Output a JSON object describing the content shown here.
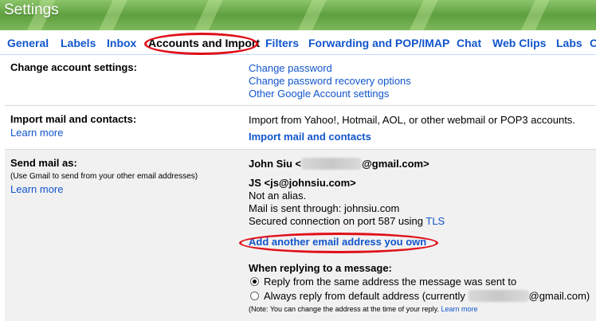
{
  "header": {
    "title": "Settings"
  },
  "tabs": [
    {
      "label": "General"
    },
    {
      "label": "Labels"
    },
    {
      "label": "Inbox"
    },
    {
      "label": "Accounts and Import"
    },
    {
      "label": "Filters"
    },
    {
      "label": "Forwarding and POP/IMAP"
    },
    {
      "label": "Chat"
    },
    {
      "label": "Web Clips"
    },
    {
      "label": "Labs"
    },
    {
      "label": "Of"
    }
  ],
  "change_account": {
    "label": "Change account settings:",
    "links": [
      "Change password",
      "Change password recovery options",
      "Other Google Account settings"
    ]
  },
  "import_mail": {
    "label": "Import mail and contacts:",
    "learn_more": "Learn more",
    "description": "Import from Yahoo!, Hotmail, AOL, or other webmail or POP3 accounts.",
    "action": "Import mail and contacts"
  },
  "send_mail": {
    "label": "Send mail as:",
    "sub": "(Use Gmail to send from your other email addresses)",
    "learn_more": "Learn more",
    "primary_name": "John Siu <",
    "primary_domain": "@gmail.com>",
    "alias_name": "JS <js@johnsiu.com>",
    "alias_line1": "Not an alias.",
    "alias_line2": "Mail is sent through: johnsiu.com",
    "alias_line3_prefix": "Secured connection on port 587 using ",
    "alias_line3_link": "TLS",
    "add_address": "Add another email address you own"
  },
  "reply": {
    "heading": "When replying to a message:",
    "option1": "Reply from the same address the message was sent to",
    "option2_prefix": "Always reply from default address (currently",
    "option2_suffix": "@gmail.com)",
    "note": "(Note: You can change the address at the time of your reply.",
    "note_link": "Learn more"
  }
}
